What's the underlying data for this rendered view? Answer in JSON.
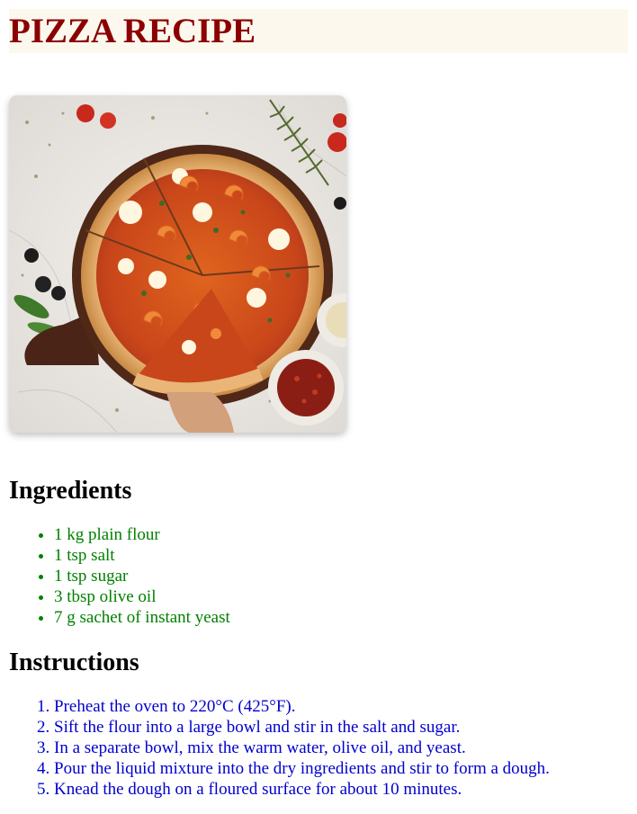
{
  "page": {
    "title": "PIZZA RECIPE"
  },
  "hero_image": {
    "icon": "pizza-photo"
  },
  "ingredients": {
    "heading": "Ingredients",
    "items": [
      "1 kg plain flour",
      "1 tsp salt",
      "1 tsp sugar",
      "3 tbsp olive oil",
      "7 g sachet of instant yeast"
    ]
  },
  "instructions": {
    "heading": "Instructions",
    "steps": [
      "Preheat the oven to 220°C (425°F).",
      "Sift the flour into a large bowl and stir in the salt and sugar.",
      "In a separate bowl, mix the warm water, olive oil, and yeast.",
      "Pour the liquid mixture into the dry ingredients and stir to form a dough.",
      "Knead the dough on a floured surface for about 10 minutes."
    ]
  },
  "colors": {
    "title": "#8b0000",
    "title_background": "#fdf8ee",
    "ingredients_text": "#008000",
    "instructions_text": "#0000cd"
  }
}
